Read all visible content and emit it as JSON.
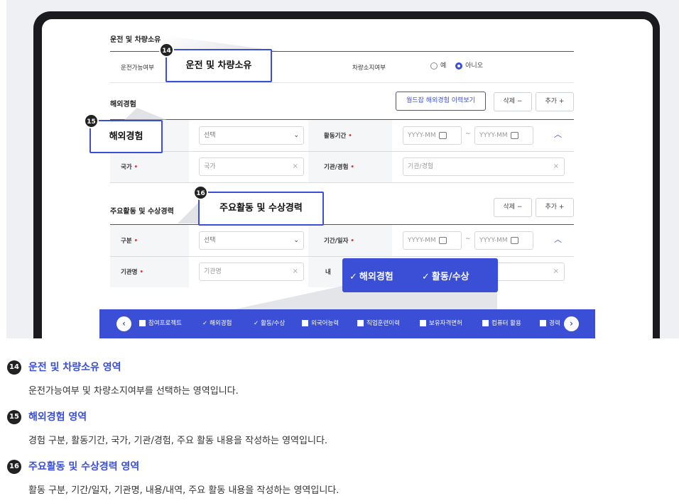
{
  "drive": {
    "section_title": "운전 및 차량소유",
    "drive_label": "운전가능여부",
    "vehicle_label": "차량소지여부",
    "radio_yes": "예",
    "radio_no": "아니오",
    "selected": "아니오"
  },
  "overseas": {
    "section_title": "해외경험",
    "worknet_button": "월드잡 해외경험 이력보기",
    "delete_button": "삭제 −",
    "add_button": "추가 +",
    "select_placeholder": "선택",
    "period_label": "활동기간",
    "date_from_placeholder": "YYYY-MM",
    "date_sep": "~",
    "date_to_placeholder": "YYYY-MM",
    "country_label": "국가",
    "country_placeholder": "국가",
    "org_label": "기관/경험",
    "org_placeholder": "기관/경험"
  },
  "activity": {
    "section_title": "주요활동 및 수상경력",
    "delete_button": "삭제 −",
    "add_button": "추가 +",
    "type_label": "구분",
    "select_placeholder": "선택",
    "period_label": "기간/일자",
    "date_from_placeholder": "YYYY-MM",
    "date_sep": "~",
    "date_to_placeholder": "YYYY-MM",
    "org_label": "기관명",
    "org_placeholder": "기관명",
    "content_label_partial": "내"
  },
  "callouts": {
    "c14": {
      "num": "14",
      "text": "운전 및 차량소유"
    },
    "c15": {
      "num": "15",
      "text": "해외경험"
    },
    "c16": {
      "num": "16",
      "text": "주요활동 및 수상경력"
    }
  },
  "popup": {
    "item1": "해외경험",
    "item2": "활동/수상"
  },
  "bottom_bar": {
    "items": [
      {
        "label": "참여프로젝트",
        "checked": false
      },
      {
        "label": "해외경험",
        "checked": true
      },
      {
        "label": "활동/수상",
        "checked": true
      },
      {
        "label": "외국어능력",
        "checked": false
      },
      {
        "label": "직업훈련이력",
        "checked": false
      },
      {
        "label": "보유자격면허",
        "checked": false
      },
      {
        "label": "컴퓨터 활용",
        "checked": false
      },
      {
        "label": "경력",
        "checked": false
      }
    ]
  },
  "descriptions": [
    {
      "num": "14",
      "title": "운전 및 차량소유 영역",
      "body": "운전가능여부 및 차량소지여부를 선택하는 영역입니다."
    },
    {
      "num": "15",
      "title": "해외경험 영역",
      "body": "경험 구분, 활동기간, 국가, 기관/경험, 주요 활동 내용을 작성하는 영역입니다."
    },
    {
      "num": "16",
      "title": "주요활동 및 수상경력 영역",
      "body": "활동 구분, 기간/일자, 기관명, 내용/내역, 주요 활동 내용을 작성하는 영역입니다."
    }
  ],
  "colors": {
    "accent": "#3b4fd6",
    "required": "#e53a3a",
    "frame": "#1b1b1f"
  }
}
